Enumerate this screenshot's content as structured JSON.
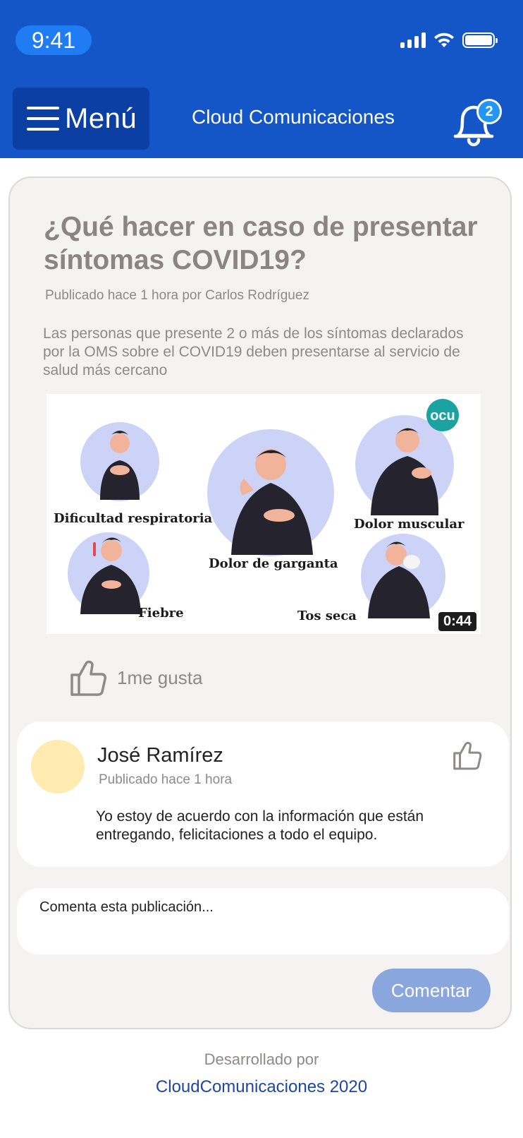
{
  "status_bar": {
    "time": "9:41"
  },
  "header": {
    "menu_label": "Menú",
    "app_title": "Cloud Comunicaciones",
    "notification_count": "2"
  },
  "post": {
    "title": "¿Qué hacer en caso de presentar síntomas COVID19?",
    "meta": "Publicado hace 1 hora por Carlos Rodríguez",
    "body": "Las personas que presente 2 o más de los síntomas declarados por la OMS sobre el COVID19 deben presentarse al servicio de salud más cercano",
    "video": {
      "duration": "0:44",
      "logo": "ocu",
      "labels": {
        "breathing": "Dificultad respiratoria",
        "throat": "Dolor de garganta",
        "muscle": "Dolor muscular",
        "fever": "Fiebre",
        "cough": "Tos seca"
      }
    },
    "likes_label": "1me gusta"
  },
  "comment": {
    "author": "José Ramírez",
    "time": "Publicado hace 1 hora",
    "text": "Yo estoy de acuerdo con la información que están entregando, felicitaciones a todo el equipo."
  },
  "comment_form": {
    "placeholder": "Comenta esta publicación...",
    "submit_label": "Comentar"
  },
  "footer": {
    "line1": "Desarrollado por",
    "line2": "CloudComunicaciones 2020"
  },
  "colors": {
    "header_bg": "#1456c8",
    "menu_bg": "#0b3fa3",
    "badge": "#2196f3",
    "button_disabled": "#8aa7dd",
    "footer_link": "#1d47a5",
    "avatar": "#fdebb0"
  },
  "icons": [
    "signal-icon",
    "wifi-icon",
    "battery-icon",
    "menu-icon",
    "bell-icon",
    "thumbs-up-icon"
  ]
}
